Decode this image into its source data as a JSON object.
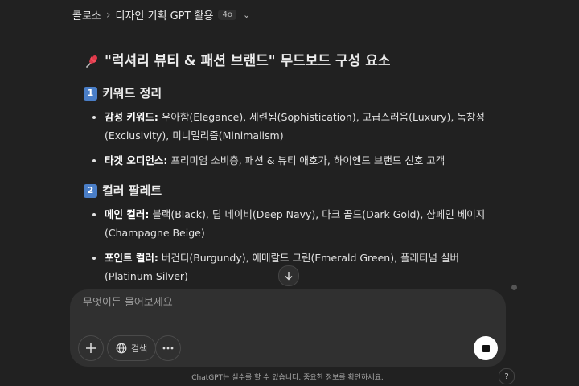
{
  "header": {
    "breadcrumb_parent": "콜로소",
    "breadcrumb_sep": "›",
    "title": "디자인 기획 GPT 활용",
    "model_badge": "4o",
    "chevron": "⌄"
  },
  "message": {
    "heading": "\"럭셔리 뷰티 & 패션 브랜드\" 무드보드 구성 요소",
    "sections": [
      {
        "number": "1",
        "title": "키워드 정리",
        "items": [
          {
            "label": "감성 키워드:",
            "text": " 우아함(Elegance), 세련됨(Sophistication), 고급스러움(Luxury), 독창성(Exclusivity), 미니멀리즘(Minimalism)"
          },
          {
            "label": "타겟 오디언스:",
            "text": " 프리미엄 소비층, 패션 & 뷰티 애호가, 하이엔드 브랜드 선호 고객"
          }
        ]
      },
      {
        "number": "2",
        "title": "컬러 팔레트",
        "items": [
          {
            "label": "메인 컬러:",
            "text": " 블랙(Black), 딥 네이비(Deep Navy), 다크 골드(Dark Gold), 샴페인 베이지(Champagne Beige)"
          },
          {
            "label": "포인트 컬러:",
            "text": " 버건디(Burgundy), 에메랄드 그린(Emerald Green), 플래티넘 실버(Platinum Silver)"
          }
        ]
      }
    ]
  },
  "composer": {
    "placeholder": "무엇이든 물어보세요",
    "search_label": "검색"
  },
  "footer": {
    "disclaimer": "ChatGPT는 실수를 할 수 있습니다. 중요한 정보를 확인하세요.",
    "help": "?"
  },
  "icons": [
    "pin-icon",
    "scroll-down-icon",
    "plus-icon",
    "globe-icon",
    "more-icon",
    "stop-icon",
    "help-icon"
  ]
}
